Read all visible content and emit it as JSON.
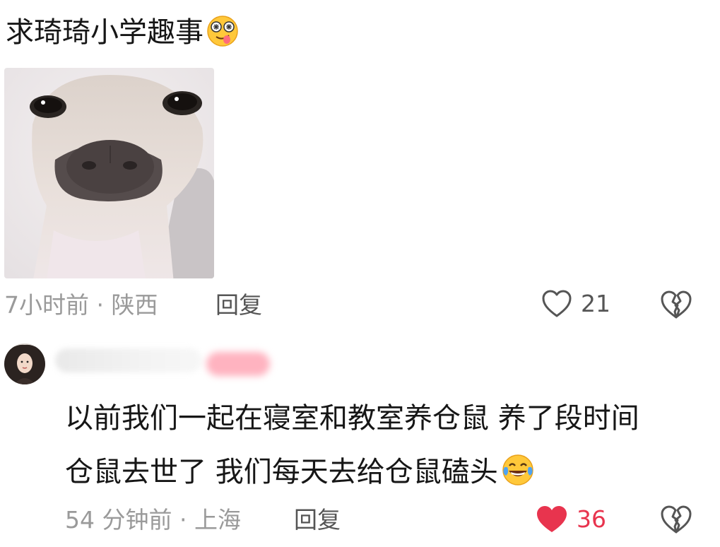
{
  "comment1": {
    "text": "求琦琦小学趣事",
    "emoji": "silly-dizzy-face-emoji",
    "meta": "7小时前 · 陕西",
    "reply_label": "回复",
    "likes": "21",
    "liked": false
  },
  "comment2": {
    "author_name_blurred": true,
    "line1": "以前我们一起在寝室和教室养仓鼠 养了段时间",
    "line2": "仓鼠去世了 我们每天去给仓鼠磕头",
    "emoji": "laughing-tears-emoji",
    "meta": "54 分钟前 · 上海",
    "reply_label": "回复",
    "likes": "36",
    "liked": true
  },
  "colors": {
    "liked_red": "#e8344e",
    "meta_gray": "#9a9a9a",
    "icon_gray": "#555555"
  }
}
